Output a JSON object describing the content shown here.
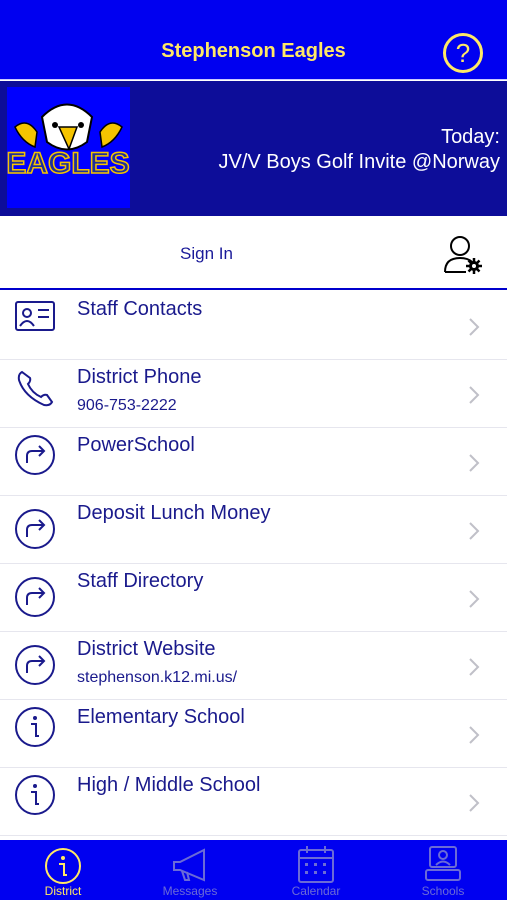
{
  "header": {
    "title": "Stephenson Eagles",
    "help_icon": "question-circle-icon"
  },
  "banner": {
    "logo_text": "EAGLES",
    "today_label": "Today:",
    "today_event": "JV/V Boys Golf Invite @Norway"
  },
  "signin": {
    "label": "Sign In",
    "icon": "user-gear-icon"
  },
  "list": {
    "items": [
      {
        "title": "Staff Contacts",
        "subtitle": "",
        "icon": "contact-card-icon"
      },
      {
        "title": "District Phone",
        "subtitle": "906-753-2222",
        "icon": "phone-icon"
      },
      {
        "title": "PowerSchool",
        "subtitle": "",
        "icon": "redirect-arrow-icon"
      },
      {
        "title": "Deposit Lunch Money",
        "subtitle": "",
        "icon": "redirect-arrow-icon"
      },
      {
        "title": "Staff Directory",
        "subtitle": "",
        "icon": "redirect-arrow-icon"
      },
      {
        "title": "District Website",
        "subtitle": "stephenson.k12.mi.us/",
        "icon": "redirect-arrow-icon"
      },
      {
        "title": "Elementary School",
        "subtitle": "",
        "icon": "info-icon"
      },
      {
        "title": "High / Middle School",
        "subtitle": "",
        "icon": "info-icon"
      }
    ]
  },
  "tabbar": {
    "tabs": [
      {
        "label": "District",
        "icon": "info-icon",
        "active": true
      },
      {
        "label": "Messages",
        "icon": "megaphone-icon",
        "active": false
      },
      {
        "label": "Calendar",
        "icon": "calendar-icon",
        "active": false
      },
      {
        "label": "Schools",
        "icon": "schools-icon",
        "active": false
      }
    ]
  },
  "colors": {
    "header_bg": "#0000f0",
    "banner_bg": "#0d0d99",
    "accent_yellow": "#ffe866",
    "text_navy": "#1a1a8c",
    "tab_inactive": "#6b6bd6"
  }
}
